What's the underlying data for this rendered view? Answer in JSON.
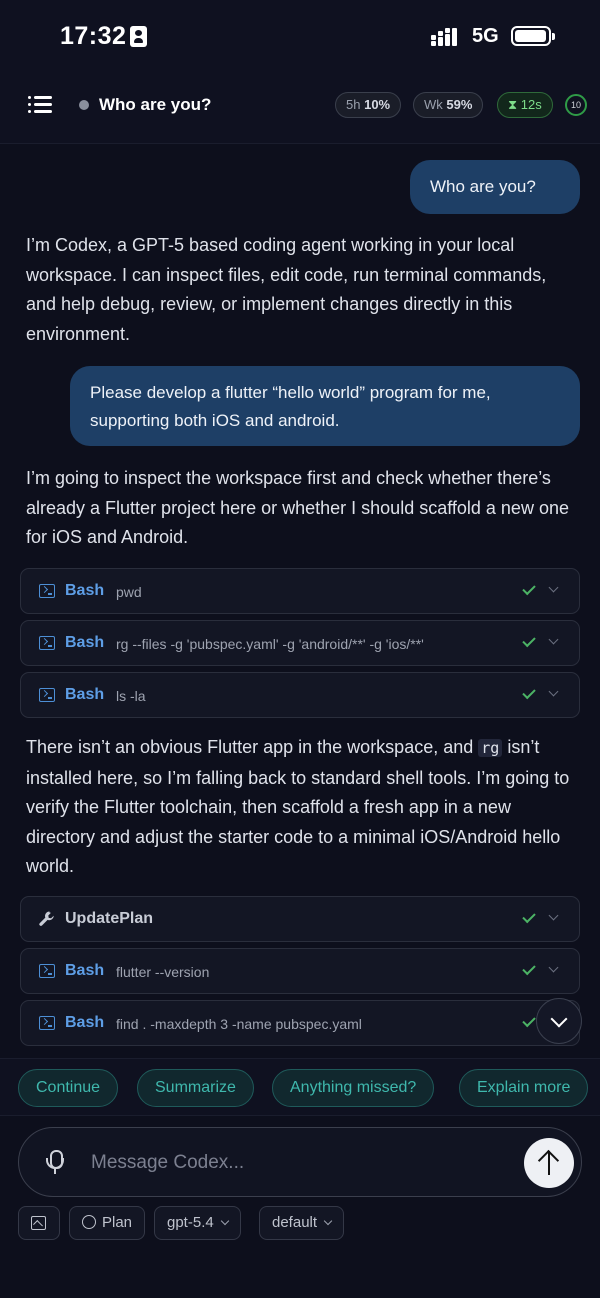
{
  "status_bar": {
    "time": "17:32",
    "network": "5G"
  },
  "header": {
    "title": "Who are you?",
    "usage_5h_label": "5h",
    "usage_5h_value": "10%",
    "usage_wk_label": "Wk",
    "usage_wk_value": "59%",
    "timer": "12s",
    "ring_value": "10"
  },
  "messages": {
    "user_1": "Who are you?",
    "assistant_1": "I’m Codex, a GPT-5 based coding agent working in your local workspace. I can inspect files, edit code, run terminal commands, and help debug, review, or implement changes directly in this environment.",
    "user_2": "Please develop a flutter “hello world” program for me, supporting both iOS and android.",
    "assistant_2": "I’m going to inspect the workspace first and check whether there’s already a Flutter project here or whether I should scaffold a new one for iOS and Android.",
    "assistant_3_part1": "There isn’t an obvious Flutter app in the workspace, and ",
    "assistant_3_code": "rg",
    "assistant_3_part2": " isn’t installed here, so I’m falling back to standard shell tools. I’m going to verify the Flutter toolchain, then scaffold a fresh app in a new directory and adjust the starter code to a minimal iOS/Android hello world."
  },
  "tools": [
    {
      "name": "Bash",
      "command": "pwd"
    },
    {
      "name": "Bash",
      "command": "rg --files -g 'pubspec.yaml' -g 'android/**' -g 'ios/**'"
    },
    {
      "name": "Bash",
      "command": "ls -la"
    },
    {
      "name": "UpdatePlan",
      "command": ""
    },
    {
      "name": "Bash",
      "command": "flutter --version"
    },
    {
      "name": "Bash",
      "command": "find . -maxdepth 3 -name pubspec.yaml"
    }
  ],
  "suggestions": [
    "Continue",
    "Summarize",
    "Anything missed?",
    "Explain more"
  ],
  "composer": {
    "placeholder": "Message Codex...",
    "plan_label": "Plan",
    "model_label": "gpt-5.4",
    "mode_label": "default"
  },
  "colors": {
    "accent_blue": "#5e9ee6",
    "user_bubble": "#1e3f66",
    "success": "#4cb365",
    "chip_teal": "#3fb8ad"
  }
}
